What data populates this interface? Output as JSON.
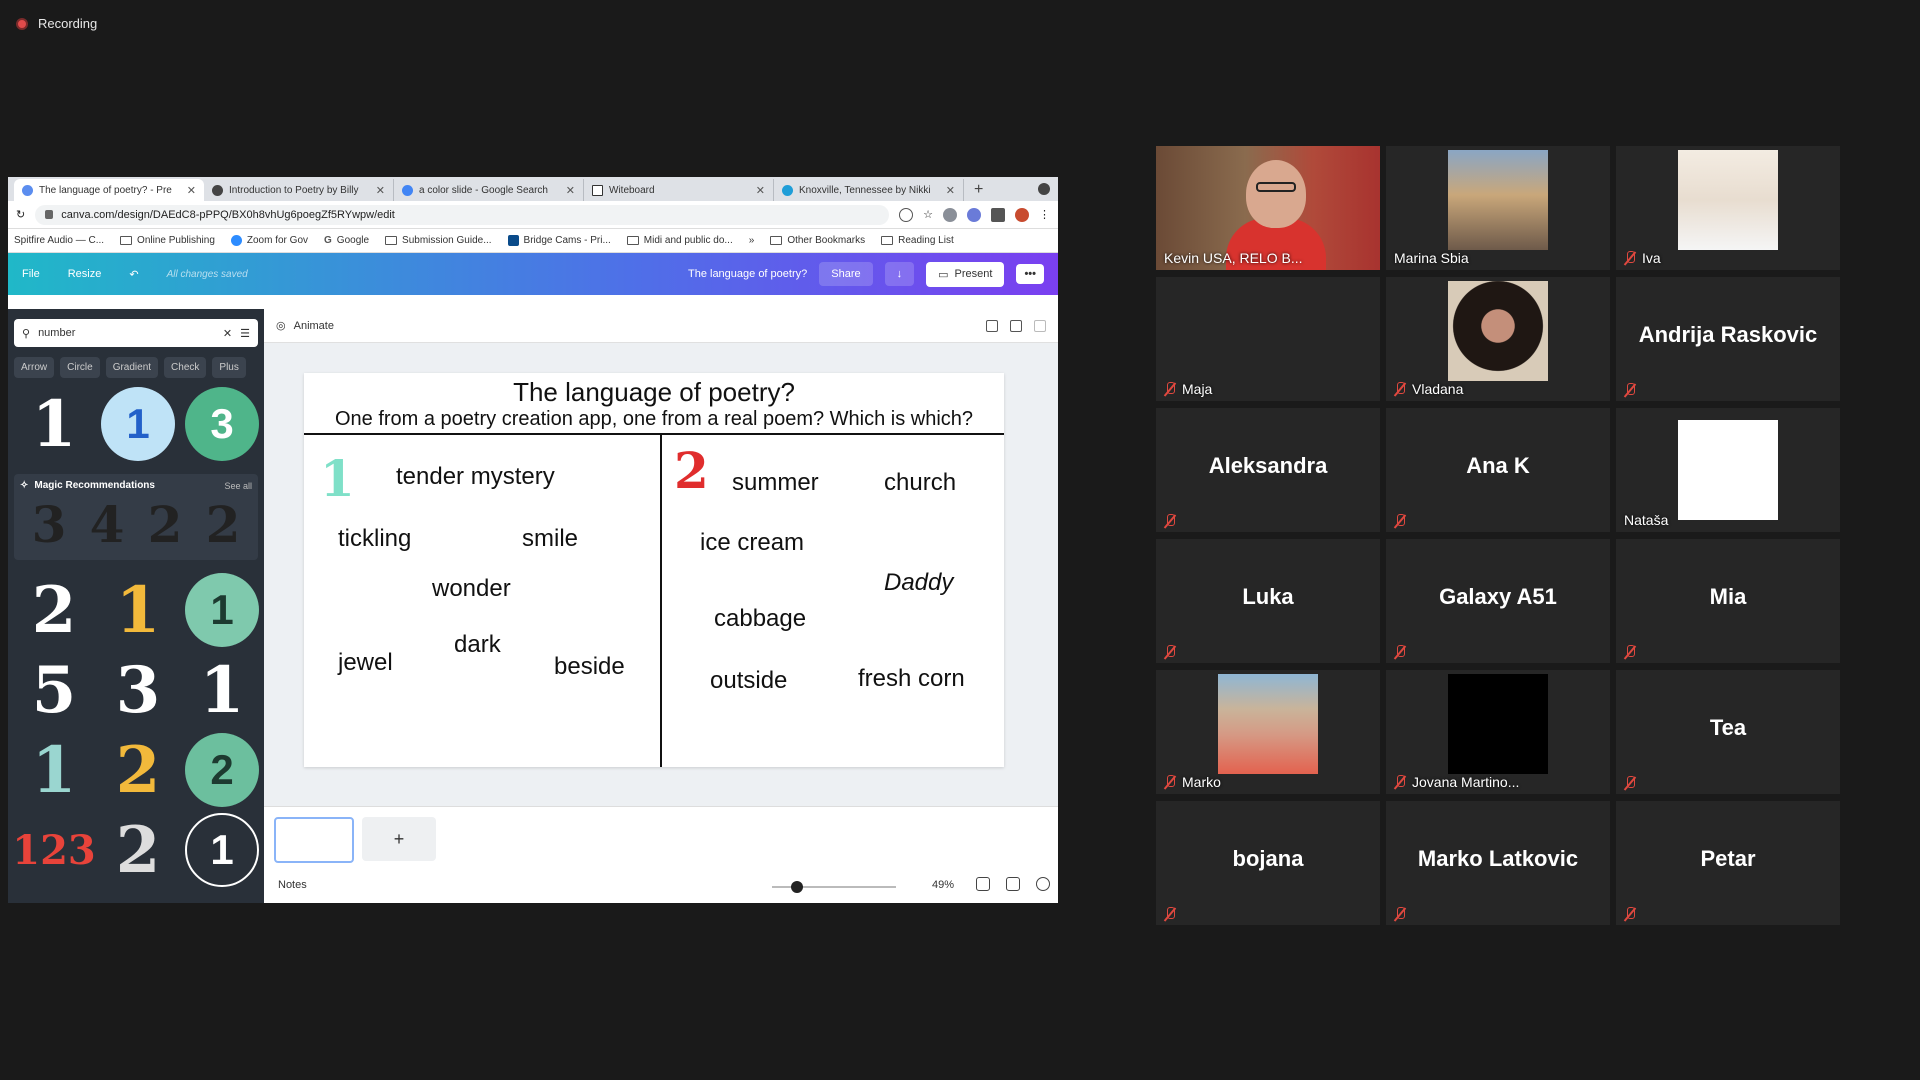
{
  "recording": {
    "label": "Recording"
  },
  "browser": {
    "tabs": [
      {
        "title": "The language of poetry? - Pre",
        "active": true
      },
      {
        "title": "Introduction to Poetry by Billy",
        "active": false
      },
      {
        "title": "a color slide - Google Search",
        "active": false
      },
      {
        "title": "Witeboard",
        "active": false
      },
      {
        "title": "Knoxville, Tennessee by Nikki",
        "active": false
      }
    ],
    "url": "canva.com/design/DAEdC8-pPPQ/BX0h8vhUg6poegZf5RYwpw/edit",
    "bookmarks": [
      "Spitfire Audio — C...",
      "Online Publishing",
      "Zoom for Gov",
      "Google",
      "Submission Guide...",
      "Bridge Cams - Pri...",
      "Midi and public do...",
      "»",
      "Other Bookmarks",
      "Reading List"
    ]
  },
  "canva": {
    "menu_file": "File",
    "menu_resize": "Resize",
    "saved_status": "All changes saved",
    "doc_title": "The language of poetry?",
    "share": "Share",
    "present": "Present",
    "more": "•••",
    "search_value": "number",
    "chips": [
      "Arrow",
      "Circle",
      "Gradient",
      "Check",
      "Plus"
    ],
    "top_numbers": [
      "1",
      "1",
      "3"
    ],
    "magic_title": "Magic Recommendations",
    "magic_see_all": "See all",
    "magic_numbers": [
      "3",
      "4",
      "2",
      "2"
    ],
    "grid_numbers": [
      [
        "2",
        "1",
        "1"
      ],
      [
        "5",
        "3",
        "1"
      ],
      [
        "1",
        "2",
        "2"
      ],
      [
        "123",
        "2",
        "1"
      ]
    ],
    "animate": "Animate",
    "notes": "Notes",
    "zoom": "49%",
    "add_page": "+",
    "zoom_level": 0.2
  },
  "slide": {
    "title": "The language of poetry?",
    "subtitle": "One from a poetry creation app, one from a real poem?  Which is which?",
    "badge_left": "1",
    "badge_right": "2",
    "left_words": [
      "tender mystery",
      "tickling",
      "smile",
      "wonder",
      "jewel",
      "dark",
      "beside"
    ],
    "right_words": [
      "summer",
      "church",
      "ice cream",
      "Daddy",
      "cabbage",
      "outside",
      "fresh corn"
    ]
  },
  "participants": [
    {
      "name": "Kevin USA, RELO B...",
      "muted": false,
      "video": "kevin",
      "active": true
    },
    {
      "name": "Marina Sbia",
      "muted": false,
      "video": "city"
    },
    {
      "name": "Iva",
      "muted": true,
      "video": "iva"
    },
    {
      "name": "Maja",
      "muted": true,
      "video": "none"
    },
    {
      "name": "Vladana",
      "muted": true,
      "video": "vladana"
    },
    {
      "name": "Andrija Raskovic",
      "muted": true,
      "video": "none",
      "big": true
    },
    {
      "name": "Aleksandra",
      "muted": true,
      "video": "none",
      "big": true
    },
    {
      "name": "Ana K",
      "muted": true,
      "video": "none",
      "big": true
    },
    {
      "name": "Nataša",
      "muted": false,
      "video": "white"
    },
    {
      "name": "Luka",
      "muted": true,
      "video": "none",
      "big": true
    },
    {
      "name": "Galaxy A51",
      "muted": true,
      "video": "none",
      "big": true
    },
    {
      "name": "Mia",
      "muted": true,
      "video": "none",
      "big": true
    },
    {
      "name": "Marko",
      "muted": true,
      "video": "marko"
    },
    {
      "name": "Jovana Martino...",
      "muted": true,
      "video": "black"
    },
    {
      "name": "Tea",
      "muted": true,
      "video": "none",
      "big": true
    },
    {
      "name": "bojana",
      "muted": true,
      "video": "none",
      "big": true
    },
    {
      "name": "Marko Latkovic",
      "muted": true,
      "video": "none",
      "big": true
    },
    {
      "name": "Petar",
      "muted": true,
      "video": "none",
      "big": true
    }
  ]
}
